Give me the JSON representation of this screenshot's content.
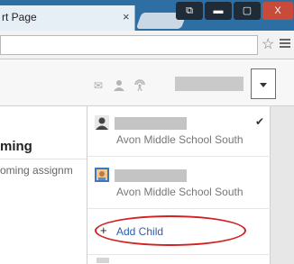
{
  "browser": {
    "tab_title": "rt Page",
    "tab_close": "×",
    "window_buttons": [
      "⧉",
      "▬",
      "▢",
      "X"
    ],
    "bookmark_star": "☆"
  },
  "appbar": {
    "icons": [
      "mail-icon",
      "person-icon",
      "radio-icon"
    ]
  },
  "page": {
    "heading": "ming",
    "subtext": "oming assignm"
  },
  "dropdown": {
    "children": [
      {
        "school": "Avon Middle School South",
        "selected": true,
        "avatar": "person-silhouette-icon"
      },
      {
        "school": "Avon Middle School South",
        "selected": false,
        "avatar": "student-photo-icon"
      }
    ],
    "add_child": {
      "plus": "+",
      "label": "Add Child"
    },
    "check": "✔"
  },
  "colors": {
    "annotation_oval": "#d32020",
    "link": "#2b5fa6"
  }
}
